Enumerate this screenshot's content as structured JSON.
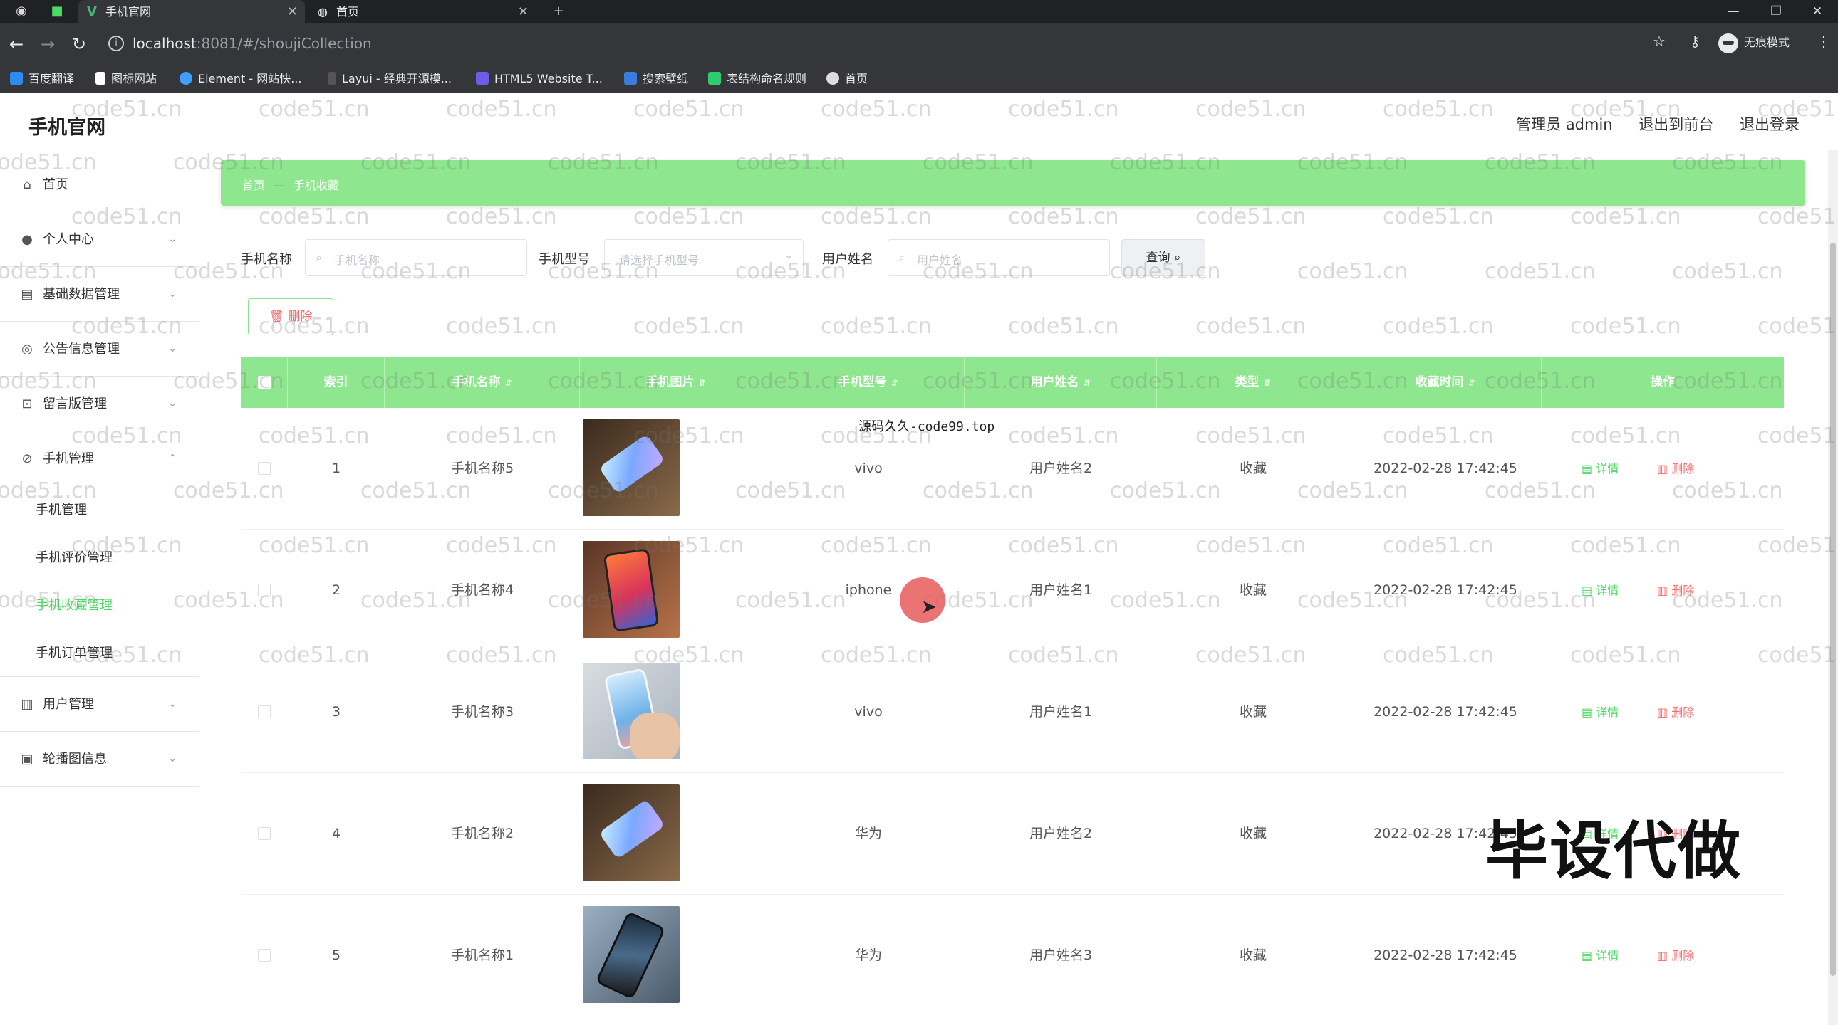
{
  "browser": {
    "tabs": [
      {
        "title": "手机官网",
        "active": true
      },
      {
        "title": "首页",
        "active": false
      }
    ],
    "new_tab": "+",
    "url_host": "localhost",
    "url_path": ":8081/#/shoujiCollection",
    "incognito_label": "无痕模式",
    "bookmarks": [
      "百度翻译",
      "图标网站",
      "Element - 网站快...",
      "Layui - 经典开源模...",
      "HTML5 Website T...",
      "搜索壁纸",
      "表结构命名规则",
      "首页"
    ]
  },
  "header": {
    "title": "手机官网",
    "admin": "管理员 admin",
    "to_front": "退出到前台",
    "logout": "退出登录"
  },
  "sidebar": {
    "items": [
      {
        "label": "首页"
      },
      {
        "label": "个人中心"
      },
      {
        "label": "基础数据管理"
      },
      {
        "label": "公告信息管理"
      },
      {
        "label": "留言版管理"
      },
      {
        "label": "手机管理"
      }
    ],
    "sub_items": [
      {
        "label": "手机管理"
      },
      {
        "label": "手机评价管理"
      },
      {
        "label": "手机收藏管理",
        "active": true
      },
      {
        "label": "手机订单管理"
      }
    ],
    "items_after": [
      {
        "label": "用户管理"
      },
      {
        "label": "轮播图信息"
      }
    ]
  },
  "breadcrumb": {
    "home": "首页",
    "current": "手机收藏"
  },
  "search": {
    "name_label": "手机名称",
    "name_placeholder": "手机名称",
    "model_label": "手机型号",
    "model_placeholder": "请选择手机型号",
    "user_label": "用户姓名",
    "user_placeholder": "用户姓名",
    "query_button": "查询"
  },
  "delete_button": "删除",
  "table": {
    "columns": [
      "索引",
      "手机名称",
      "手机图片",
      "手机型号",
      "用户姓名",
      "类型",
      "收藏时间",
      "操作"
    ],
    "rows": [
      {
        "index": "1",
        "name": "手机名称5",
        "model": "vivo",
        "user": "用户姓名2",
        "type": "收藏",
        "time": "2022-02-28 17:42:45"
      },
      {
        "index": "2",
        "name": "手机名称4",
        "model": "iphone",
        "user": "用户姓名1",
        "type": "收藏",
        "time": "2022-02-28 17:42:45"
      },
      {
        "index": "3",
        "name": "手机名称3",
        "model": "vivo",
        "user": "用户姓名1",
        "type": "收藏",
        "time": "2022-02-28 17:42:45"
      },
      {
        "index": "4",
        "name": "手机名称2",
        "model": "华为",
        "user": "用户姓名2",
        "type": "收藏",
        "time": "2022-02-28 17:42:45"
      },
      {
        "index": "5",
        "name": "手机名称1",
        "model": "华为",
        "user": "用户姓名3",
        "type": "收藏",
        "time": "2022-02-28 17:42:45"
      }
    ],
    "detail_label": "详情",
    "delete_label": "删除"
  },
  "overlay": {
    "center_watermark": "源码久久-code99.top",
    "promo": "毕设代做",
    "tile_watermark": "code51.cn"
  },
  "colors": {
    "accent_green": "#8ee68e",
    "active_text": "#4cd964",
    "danger": "#f56c6c"
  }
}
